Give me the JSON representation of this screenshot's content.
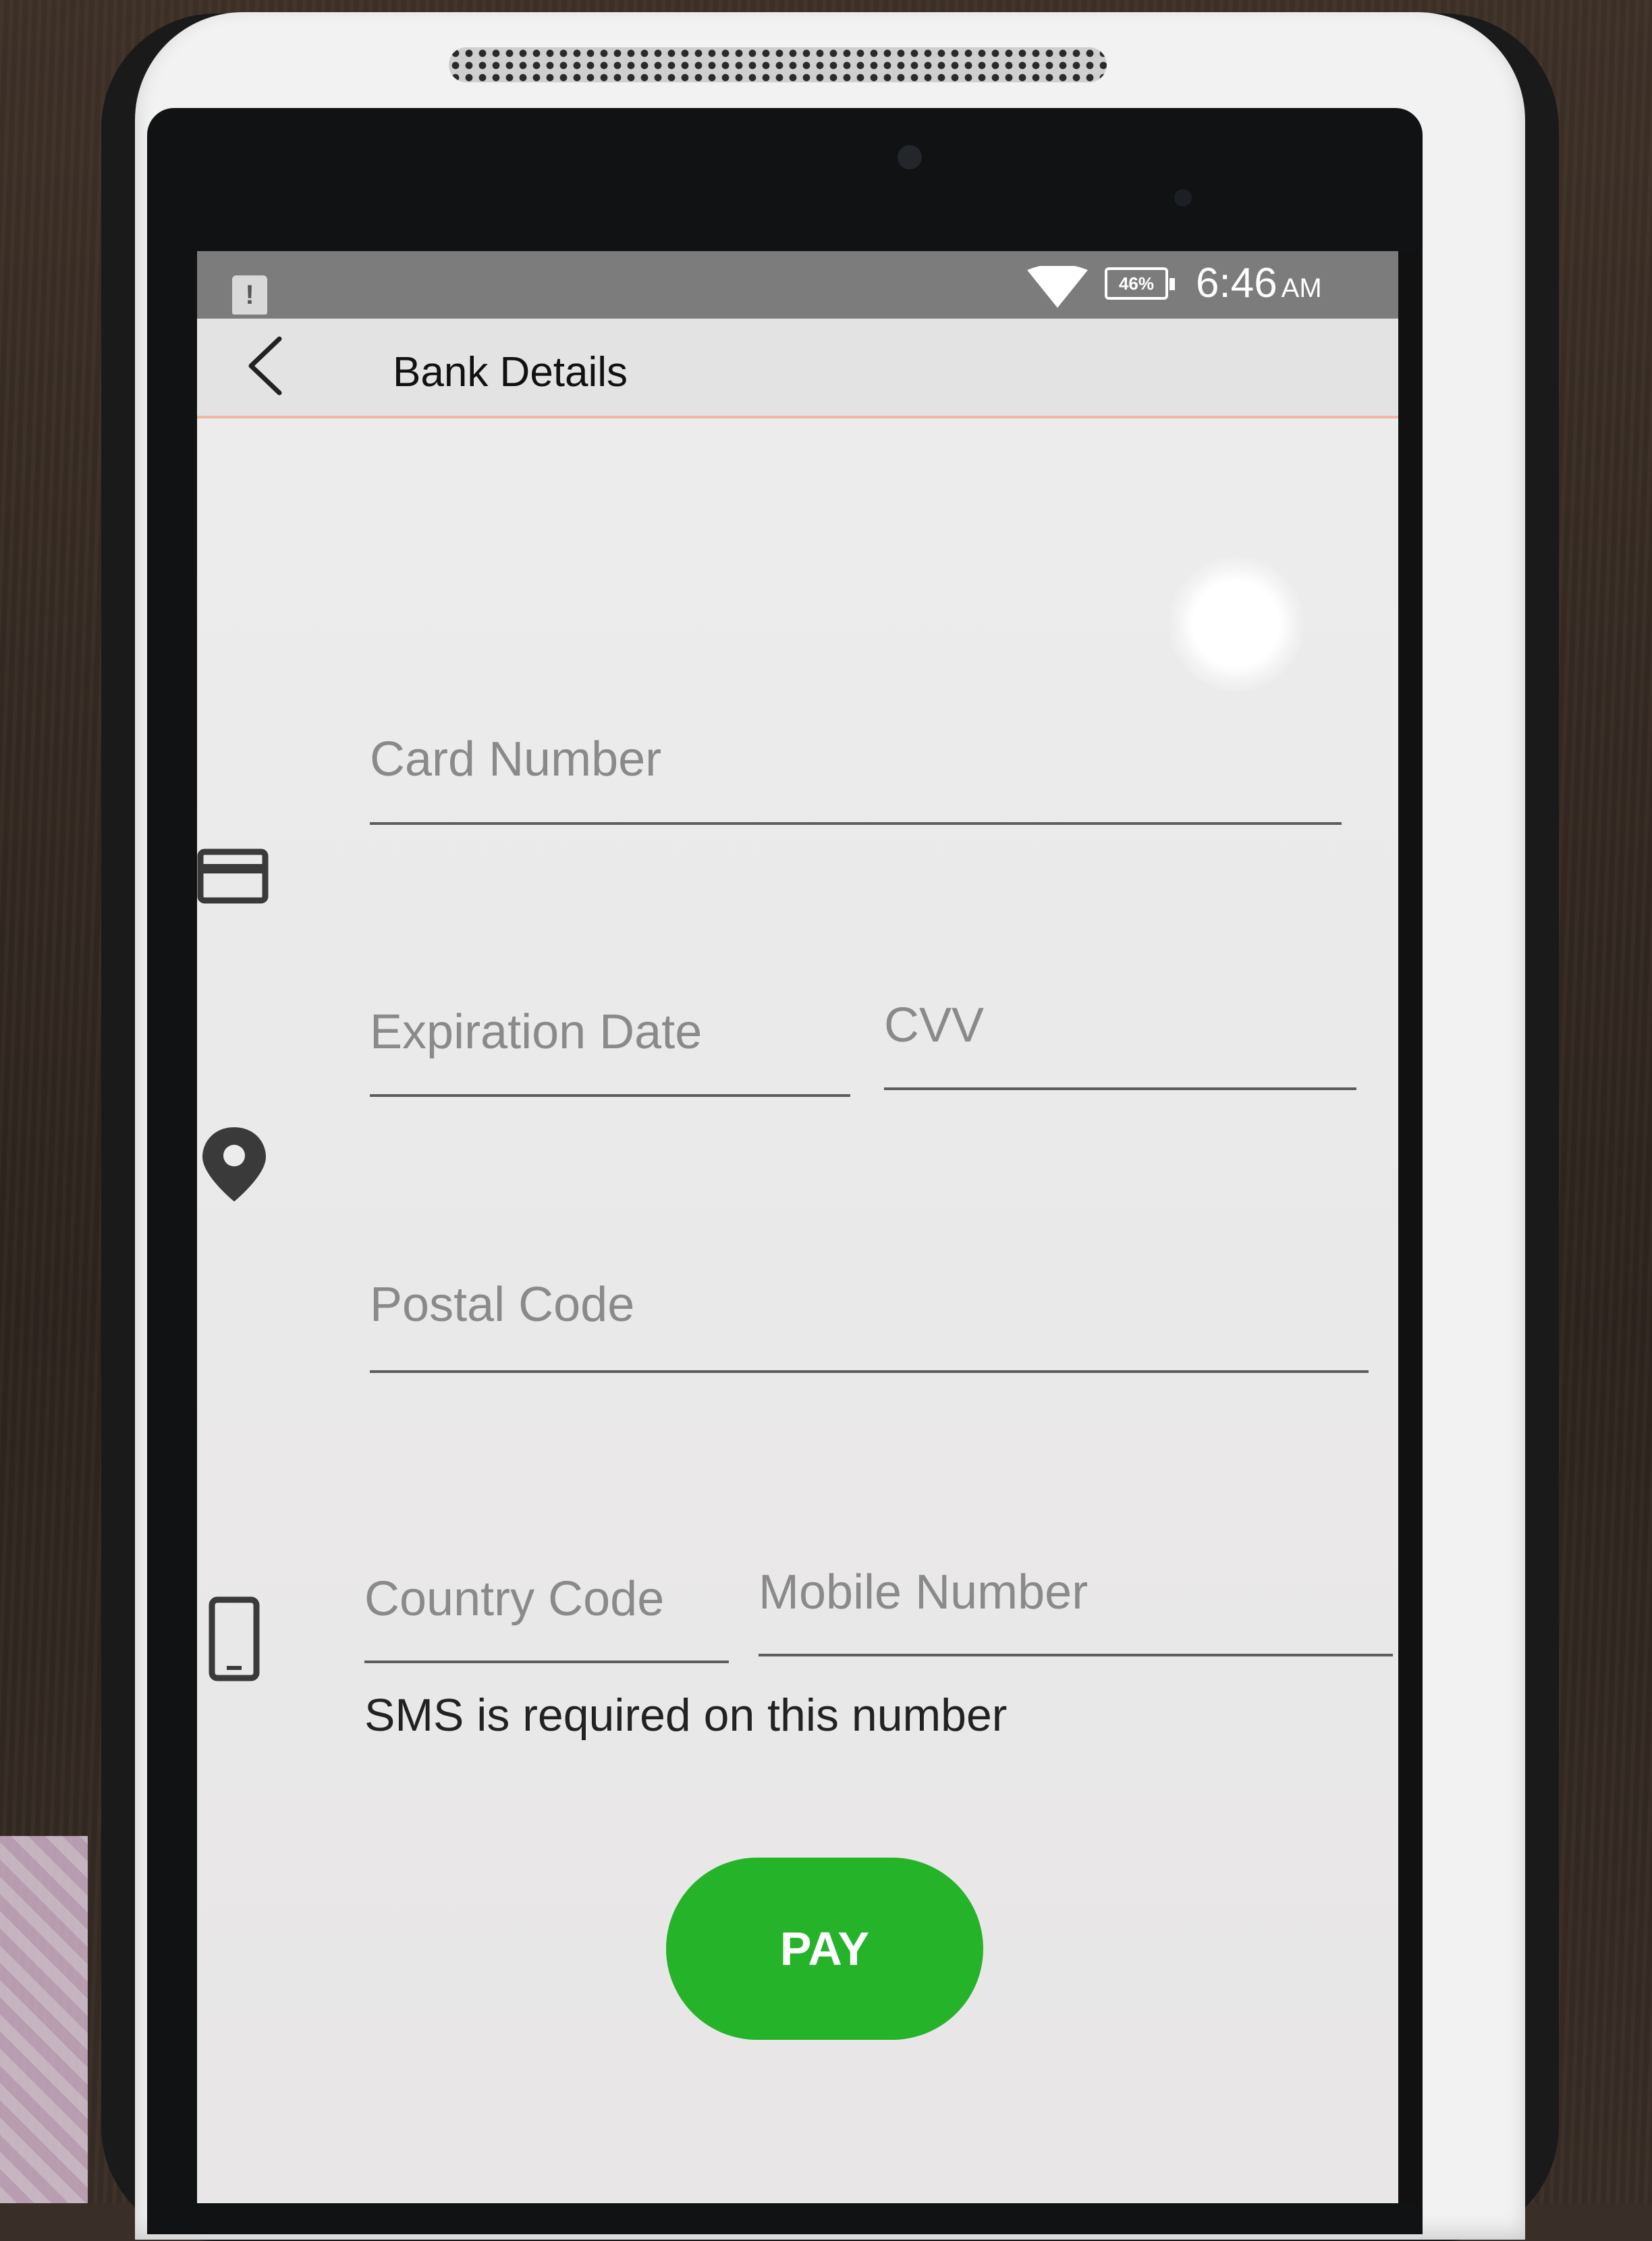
{
  "status_bar": {
    "notification_icon": "!",
    "battery": "46%",
    "time": "6:46",
    "ampm": "AM"
  },
  "app_bar": {
    "title": "Bank Details",
    "back_icon": "chevron-left-icon"
  },
  "form": {
    "card_number": {
      "placeholder": "Card Number",
      "icon": "credit-card-icon"
    },
    "expiration_date": {
      "placeholder": "Expiration Date"
    },
    "cvv": {
      "placeholder": "CVV"
    },
    "postal_code": {
      "placeholder": "Postal Code",
      "icon": "location-pin-icon"
    },
    "country_code": {
      "placeholder": "Country Code",
      "icon": "mobile-phone-icon"
    },
    "mobile_number": {
      "placeholder": "Mobile Number"
    },
    "helper_text": "SMS is required on this number"
  },
  "actions": {
    "pay_label": "PAY"
  },
  "colors": {
    "pay_button": "#25b32a",
    "app_bar_border": "#f1b7a2",
    "status_bar": "#7c7c7c"
  }
}
